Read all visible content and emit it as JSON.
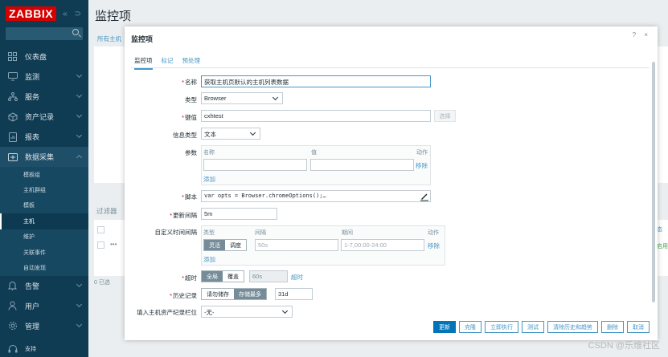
{
  "sidebar": {
    "logo": "ZABBIX",
    "collapse_glyphs": "« ⊃",
    "menu": [
      {
        "label": "仪表盘"
      },
      {
        "label": "监测"
      },
      {
        "label": "服务"
      },
      {
        "label": "资产记录"
      },
      {
        "label": "报表"
      },
      {
        "label": "数据采集"
      }
    ],
    "submenu": [
      "模板组",
      "主机群组",
      "模板",
      "主机",
      "维护",
      "关联事件",
      "自动发现"
    ],
    "menu_bottom": [
      {
        "label": "告警"
      },
      {
        "label": "用户"
      },
      {
        "label": "管理"
      },
      {
        "label": "支持"
      }
    ]
  },
  "page": {
    "title": "监控项",
    "breadcrumb": "所有主机",
    "filter_label": "过滤器",
    "selected_count": "0 已选",
    "right_text_1": "态",
    "right_text_2": "启用",
    "row_dots": "•••"
  },
  "modal": {
    "title": "监控项",
    "controls": "? ×",
    "tabs": [
      "监控项",
      "标记",
      "预处理"
    ],
    "fields": {
      "name_label": "名称",
      "name_value": "获取主机页默认的主机列表数据",
      "type_label": "类型",
      "type_value": "Browser",
      "key_label": "键值",
      "key_value": "cxhtest",
      "select_btn": "选择",
      "info_type_label": "信息类型",
      "info_type_value": "文本",
      "params_label": "参数",
      "params_col_name": "名称",
      "params_col_value": "值",
      "params_col_action": "动作",
      "params_remove": "移除",
      "params_add": "添加",
      "script_label": "脚本",
      "script_value": "var opts = Browser.chromeOptions();…",
      "interval_label": "更新间隔",
      "interval_value": "5m",
      "custom_label": "自定义时间间隔",
      "custom_col_type": "类型",
      "custom_col_interval": "间隔",
      "custom_col_period": "期间",
      "custom_col_action": "动作",
      "custom_seg_flex": "灵活",
      "custom_seg_sched": "调度",
      "custom_interval_ph": "50s",
      "custom_period_ph": "1-7,00:00-24:00",
      "custom_remove": "移除",
      "custom_add": "添加",
      "timeout_label": "超时",
      "timeout_global": "全局",
      "timeout_override": "覆盖",
      "timeout_value": "60s",
      "timeout_link": "超时",
      "history_label": "历史记录",
      "history_no": "请勿储存",
      "history_store": "存储最多",
      "history_value": "31d",
      "inventory_label": "填入主机资产纪录栏位",
      "inventory_value": "-无-"
    },
    "buttons": [
      "更新",
      "克隆",
      "立即执行",
      "测试",
      "清除历史和趋势",
      "删除",
      "取消"
    ]
  },
  "watermark": "CSDN @乐维社区"
}
